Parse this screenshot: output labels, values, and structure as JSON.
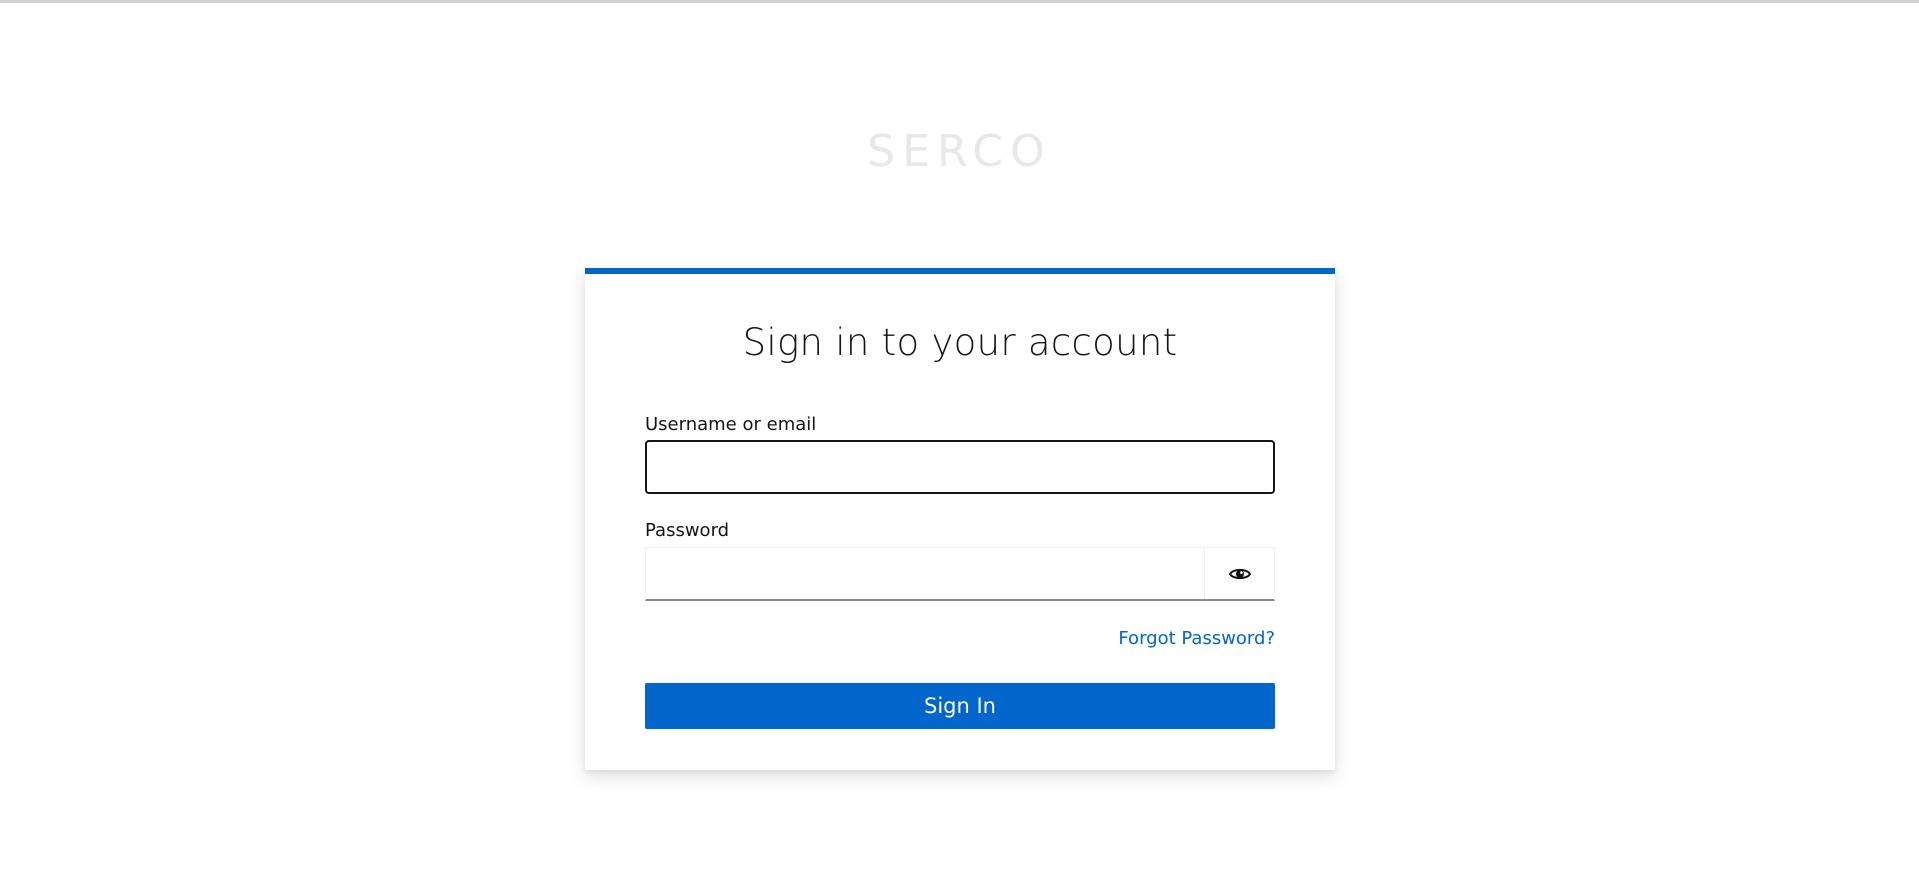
{
  "brand": {
    "name": "SERCO",
    "color": "#e8e8e8"
  },
  "login": {
    "title": "Sign in to your account",
    "username": {
      "label": "Username or email",
      "value": "",
      "placeholder": ""
    },
    "password": {
      "label": "Password",
      "value": "",
      "placeholder": "",
      "reveal_icon": "eye-icon"
    },
    "forgot_link": "Forgot Password?",
    "submit_label": "Sign In"
  },
  "colors": {
    "accent": "#0066cc",
    "link": "#0066cc",
    "text": "#151515",
    "background": "#ffffff"
  }
}
